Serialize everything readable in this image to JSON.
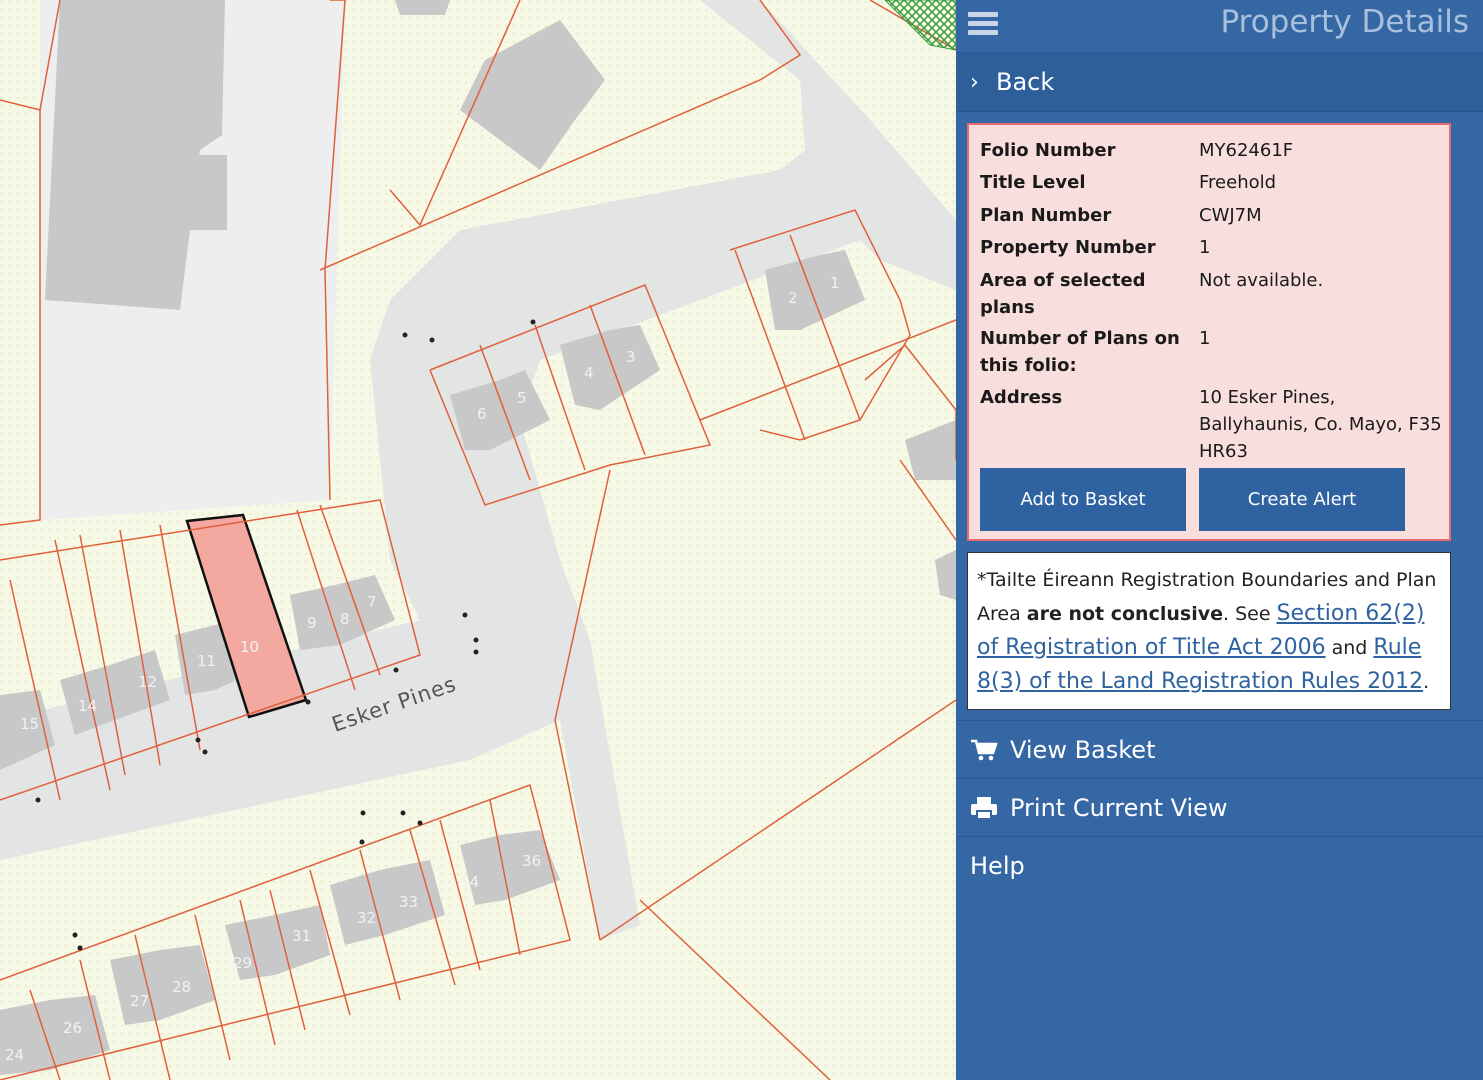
{
  "panel": {
    "title": "Property Details",
    "back_label": "Back",
    "details": [
      {
        "key": "Folio Number",
        "value": "MY62461F"
      },
      {
        "key": "Title Level",
        "value": "Freehold"
      },
      {
        "key": "Plan Number",
        "value": "CWJ7M"
      },
      {
        "key": "Property Number",
        "value": "1"
      },
      {
        "key": "Area of selected plans",
        "value": "Not available."
      },
      {
        "key": "Number of Plans on this folio:",
        "value": "1"
      },
      {
        "key": "Address",
        "value": "10 Esker Pines, Ballyhaunis, Co. Mayo, F35 HR63"
      }
    ],
    "add_basket_label": "Add to Basket",
    "create_alert_label": "Create Alert",
    "notice": {
      "prefix": "*Tailte Éireann Registration Boundaries and Plan Area ",
      "bold": "are not conclusive",
      "middle": ". See ",
      "link1": "Section 62(2) of Registration of Title Act 2006",
      "and": " and ",
      "link2": "Rule 8(3) of the Land Registration Rules 2012",
      "suffix": "."
    },
    "menu": {
      "view_basket": "View Basket",
      "print_view": "Print Current View",
      "help": "Help"
    }
  },
  "map": {
    "road_name": "Esker Pines",
    "house_numbers": [
      "1",
      "2",
      "3",
      "4",
      "5",
      "6",
      "7",
      "8",
      "9",
      "10",
      "11",
      "12",
      "14",
      "15",
      "24",
      "26",
      "27",
      "28",
      "29",
      "31",
      "32",
      "33",
      "34",
      "36"
    ],
    "colors": {
      "land": "#f5f9e6",
      "road": "#e3e5e5",
      "building": "#c8c8c8",
      "boundary": "#e0603c",
      "selected": "#f4a9a0"
    }
  }
}
